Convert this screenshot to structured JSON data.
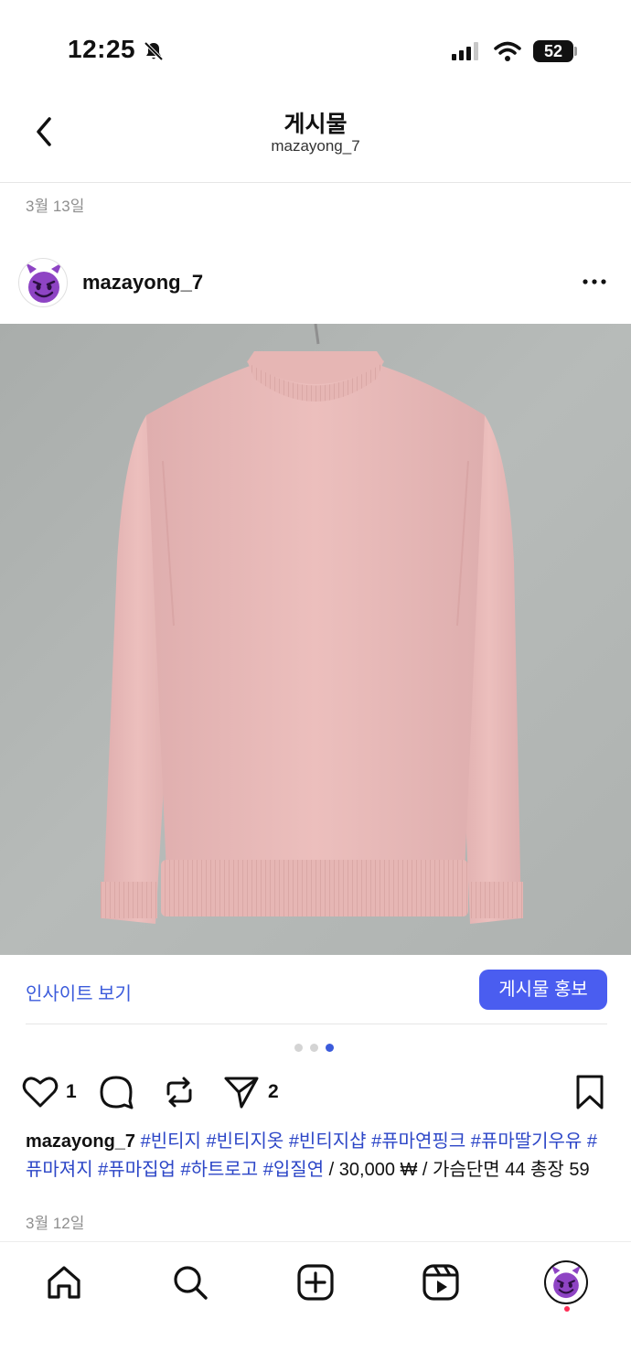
{
  "status_bar": {
    "time": "12:25",
    "battery": "52"
  },
  "header": {
    "title": "게시물",
    "subtitle": "mazayong_7"
  },
  "date_top": "3월 13일",
  "post": {
    "username": "mazayong_7",
    "insights_label": "인사이트 보기",
    "boost_label": "게시물 홍보",
    "likes": "1",
    "shares": "2",
    "caption": {
      "username": "mazayong_7",
      "tags": [
        "#빈티지",
        "#빈티지옷",
        "#빈티지샵",
        "#퓨마연핑크",
        "#퓨마딸기우유",
        "#퓨마져지",
        "#퓨마집업",
        "#하트로고",
        "#입질연"
      ],
      "text": "/ 30,000 ₩ / 가슴단면 44 총장 59"
    },
    "date": "3월 12일",
    "carousel": {
      "count": 3,
      "active_index": 2
    }
  },
  "colors": {
    "accent": "#4a5df0",
    "link": "#3b5bdb",
    "hashtag": "#2c46c7",
    "muted": "#8e8e8e",
    "photo_bg": "#b4b8b6",
    "jacket": "#e8b8b8"
  },
  "icons": [
    "bell-slash-icon",
    "signal-icon",
    "wifi-icon",
    "back-icon",
    "more-icon",
    "heart-icon",
    "comment-icon",
    "repost-icon",
    "share-icon",
    "bookmark-icon",
    "home-icon",
    "search-icon",
    "create-icon",
    "reels-icon"
  ]
}
